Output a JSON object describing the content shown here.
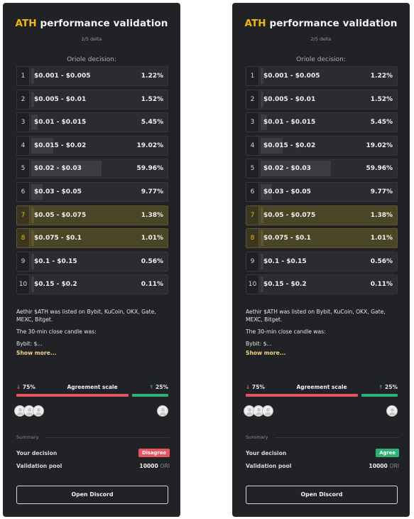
{
  "cards": [
    {
      "title_accent": "ATH",
      "title_rest": " performance validation",
      "subtitle": "2/5 delta",
      "decision_label": "Oriole decision:",
      "ranges": [
        {
          "num": "1",
          "label": "$0.001 - $0.005",
          "pct": "1.22%",
          "share": 0.0122,
          "highlight": false
        },
        {
          "num": "2",
          "label": "$0.005 - $0.01",
          "pct": "1.52%",
          "share": 0.0152,
          "highlight": false
        },
        {
          "num": "3",
          "label": "$0.01 - $0.015",
          "pct": "5.45%",
          "share": 0.0545,
          "highlight": false
        },
        {
          "num": "4",
          "label": "$0.015 - $0.02",
          "pct": "19.02%",
          "share": 0.1902,
          "highlight": false
        },
        {
          "num": "5",
          "label": "$0.02 - $0.03",
          "pct": "59.96%",
          "share": 0.5996,
          "highlight": false
        },
        {
          "num": "6",
          "label": "$0.03 - $0.05",
          "pct": "9.77%",
          "share": 0.0977,
          "highlight": false
        },
        {
          "num": "7",
          "label": "$0.05 - $0.075",
          "pct": "1.38%",
          "share": 0.0138,
          "highlight": true
        },
        {
          "num": "8",
          "label": "$0.075 - $0.1",
          "pct": "1.01%",
          "share": 0.0101,
          "highlight": true
        },
        {
          "num": "9",
          "label": "$0.1 - $0.15",
          "pct": "0.56%",
          "share": 0.0056,
          "highlight": false
        },
        {
          "num": "10",
          "label": "$0.15 - $0.2",
          "pct": "0.11%",
          "share": 0.0011,
          "highlight": false
        }
      ],
      "desc_p1": "Aethir $ATH was listed on Bybit, KuCoin, OKX, Gate, MEXC, Bitget.",
      "desc_p2": "The 30-min close candle was:",
      "desc_p3": "Bybit: $...",
      "show_more": "Show more...",
      "agree_left": "75%",
      "agree_center": "Agreement scale",
      "agree_right": "25%",
      "disagree_share": 0.75,
      "agree_share": 0.25,
      "summary_label": "Summary",
      "decision_key": "Your decision",
      "decision_value": "Disagree",
      "decision_color": "red",
      "pool_key": "Validation pool",
      "pool_value": "10000",
      "pool_unit": "ORI",
      "discord_label": "Open Discord"
    },
    {
      "title_accent": "ATH",
      "title_rest": " performance validation",
      "subtitle": "2/5 delta",
      "decision_label": "Oriole decision:",
      "ranges": [
        {
          "num": "1",
          "label": "$0.001 - $0.005",
          "pct": "1.22%",
          "share": 0.0122,
          "highlight": false
        },
        {
          "num": "2",
          "label": "$0.005 - $0.01",
          "pct": "1.52%",
          "share": 0.0152,
          "highlight": false
        },
        {
          "num": "3",
          "label": "$0.01 - $0.015",
          "pct": "5.45%",
          "share": 0.0545,
          "highlight": false
        },
        {
          "num": "4",
          "label": "$0.015 - $0.02",
          "pct": "19.02%",
          "share": 0.1902,
          "highlight": false
        },
        {
          "num": "5",
          "label": "$0.02 - $0.03",
          "pct": "59.96%",
          "share": 0.5996,
          "highlight": false
        },
        {
          "num": "6",
          "label": "$0.03 - $0.05",
          "pct": "9.77%",
          "share": 0.0977,
          "highlight": false
        },
        {
          "num": "7",
          "label": "$0.05 - $0.075",
          "pct": "1.38%",
          "share": 0.0138,
          "highlight": true
        },
        {
          "num": "8",
          "label": "$0.075 - $0.1",
          "pct": "1.01%",
          "share": 0.0101,
          "highlight": true
        },
        {
          "num": "9",
          "label": "$0.1 - $0.15",
          "pct": "0.56%",
          "share": 0.0056,
          "highlight": false
        },
        {
          "num": "10",
          "label": "$0.15 - $0.2",
          "pct": "0.11%",
          "share": 0.0011,
          "highlight": false
        }
      ],
      "desc_p1": "Aethir $ATH was listed on Bybit, KuCoin, OKX, Gate, MEXC, Bitget.",
      "desc_p2": "The 30-min close candle was:",
      "desc_p3": "Bybit: $...",
      "show_more": "Show more...",
      "agree_left": "75%",
      "agree_center": "Agreement scale",
      "agree_right": "25%",
      "disagree_share": 0.75,
      "agree_share": 0.25,
      "summary_label": "Summary",
      "decision_key": "Your decision",
      "decision_value": "Agree",
      "decision_color": "green",
      "pool_key": "Validation pool",
      "pool_value": "10000",
      "pool_unit": "ORI",
      "discord_label": "Open Discord"
    }
  ]
}
